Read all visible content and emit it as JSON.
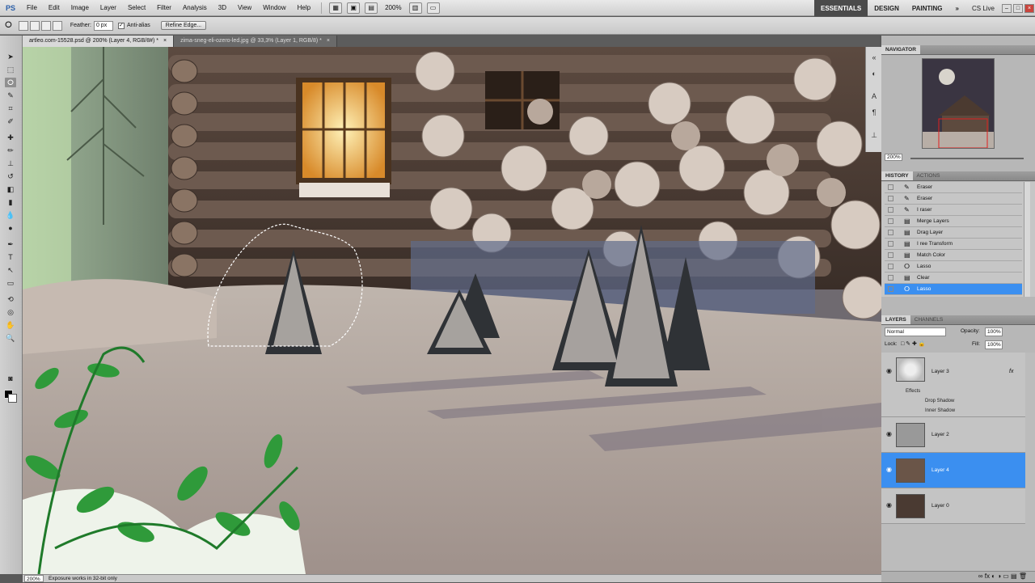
{
  "app": {
    "logo": "PS",
    "menus": [
      "File",
      "Edit",
      "Image",
      "Layer",
      "Select",
      "Filter",
      "Analysis",
      "3D",
      "View",
      "Window",
      "Help"
    ],
    "zoom": "200%",
    "workspaces": [
      "ESSENTIALS",
      "DESIGN",
      "PAINTING"
    ],
    "more_workspaces": "»",
    "cs_live": "CS Live"
  },
  "options": {
    "feather_label": "Feather:",
    "feather_value": "0 px",
    "antialias_label": "Anti-alias",
    "refine_edge": "Refine Edge..."
  },
  "tabs": [
    {
      "label": "artleo.com-15528.psd @ 200% (Layer 4, RGB/8#) *",
      "close": "×"
    },
    {
      "label": "zima-sneg-eli-ozero-led.jpg @ 33,3% (Layer 1, RGB/8) *",
      "close": "×"
    }
  ],
  "navigator": {
    "title": "NAVIGATOR",
    "zoom": "200%"
  },
  "history": {
    "tabs": [
      "HISTORY",
      "ACTIONS"
    ],
    "items": [
      {
        "label": "Eraser",
        "icon": "eraser-icon"
      },
      {
        "label": "Eraser",
        "icon": "eraser-icon"
      },
      {
        "label": "I raser",
        "icon": "eraser-icon"
      },
      {
        "label": "Merge Layers",
        "icon": "layer-icon"
      },
      {
        "label": "Drag Layer",
        "icon": "layer-icon"
      },
      {
        "label": "I ree Transform",
        "icon": "layer-icon"
      },
      {
        "label": "Match Color",
        "icon": "layer-icon"
      },
      {
        "label": "Lasso",
        "icon": "lasso-icon"
      },
      {
        "label": "Clear",
        "icon": "layer-icon"
      },
      {
        "label": "Lasso",
        "icon": "lasso-icon"
      }
    ],
    "selected_index": 9
  },
  "layers": {
    "tabs": [
      "LAYERS",
      "CHANNELS"
    ],
    "blend_mode": "Normal",
    "opacity_label": "Opacity:",
    "opacity": "100%",
    "lock_label": "Lock:",
    "fill_label": "Fill:",
    "fill": "100%",
    "items": [
      {
        "name": "Layer 3",
        "fx": "fx"
      },
      {
        "name": "Layer 2"
      },
      {
        "name": "Layer 4"
      },
      {
        "name": "Layer 0"
      }
    ],
    "effects_label": "Effects",
    "effects": [
      "Drop Shadow",
      "Inner Shadow"
    ],
    "selected": "Layer 4"
  },
  "status": {
    "zoom": "200%",
    "info": "Exposure works in 32-bit only"
  },
  "colors": {
    "selection_blue": "#3b8ff0",
    "active_workspace": "#4b4b4b"
  }
}
